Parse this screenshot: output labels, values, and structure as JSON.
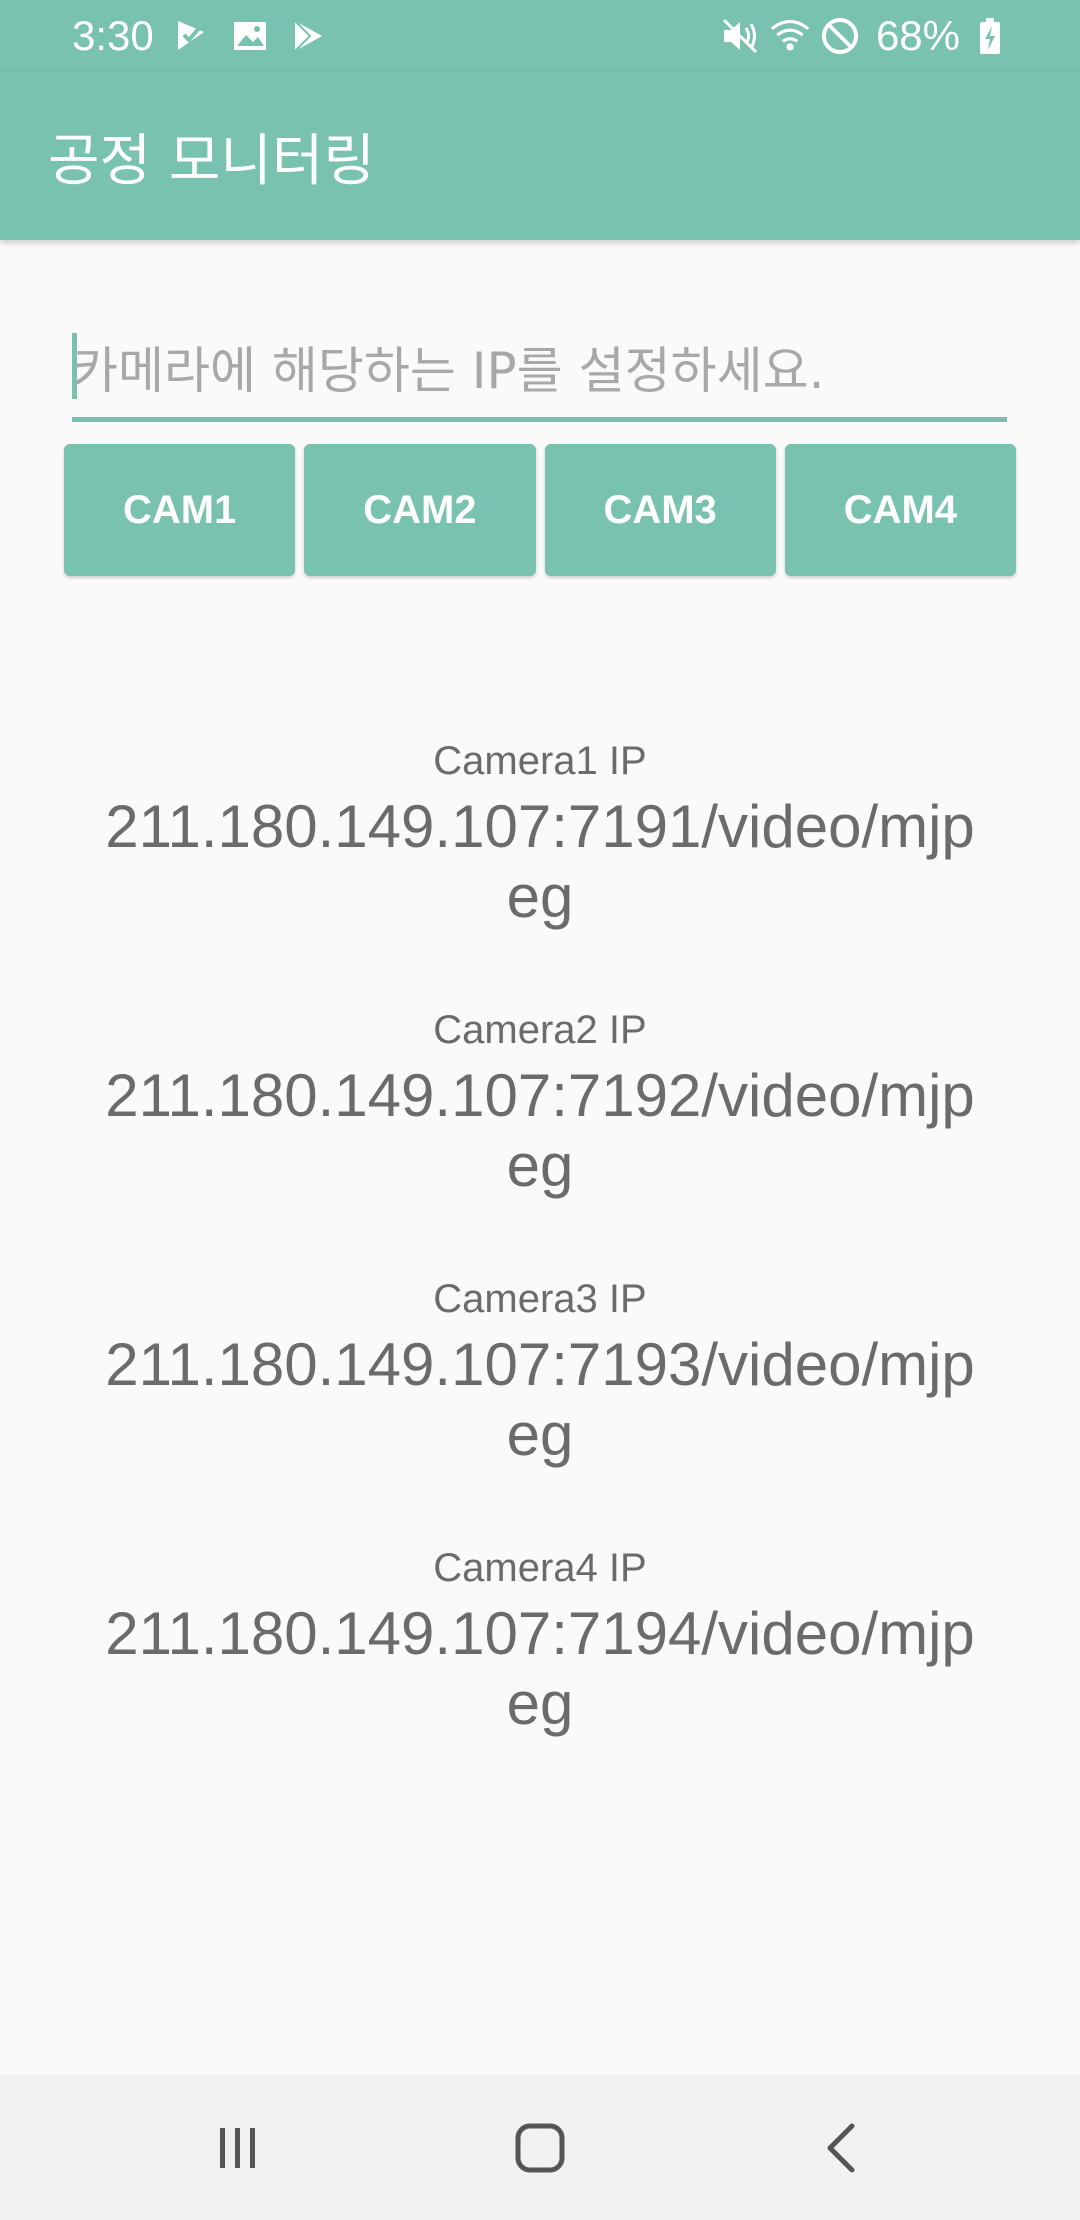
{
  "status_bar": {
    "time": "3:30",
    "battery": "68%",
    "left_icons": [
      "check-app-icon",
      "gallery-icon",
      "play-store-icon"
    ],
    "right_icons": [
      "mute-icon",
      "wifi-icon",
      "do-not-disturb-icon",
      "battery-charging-icon"
    ]
  },
  "app_bar": {
    "title": "공정 모니터링",
    "color": "#79c2b0"
  },
  "ip_input": {
    "placeholder": "카메라에 해당하는 IP를 설정하세요.",
    "value": ""
  },
  "cam_buttons": [
    "CAM1",
    "CAM2",
    "CAM3",
    "CAM4"
  ],
  "cameras": [
    {
      "label": "Camera1 IP",
      "url": "211.180.149.107:7191/video/mjpeg"
    },
    {
      "label": "Camera2 IP",
      "url": "211.180.149.107:7192/video/mjpeg"
    },
    {
      "label": "Camera3 IP",
      "url": "211.180.149.107:7193/video/mjpeg"
    },
    {
      "label": "Camera4 IP",
      "url": "211.180.149.107:7194/video/mjpeg"
    }
  ],
  "nav_bar": {
    "icons": [
      "recent-apps-icon",
      "home-icon",
      "back-icon"
    ]
  }
}
